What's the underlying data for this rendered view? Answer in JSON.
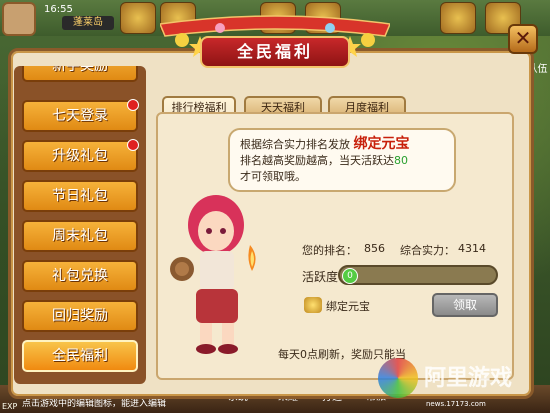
{
  "hud": {
    "time": "16:55",
    "server": "蓬莱岛"
  },
  "dialog": {
    "title": "全民福利",
    "close_label": "✕"
  },
  "menu": {
    "items": [
      {
        "label": "新手奖励",
        "badge": false
      },
      {
        "label": "七天登录",
        "badge": true
      },
      {
        "label": "升级礼包",
        "badge": true
      },
      {
        "label": "节日礼包",
        "badge": false
      },
      {
        "label": "周末礼包",
        "badge": false
      },
      {
        "label": "礼包兑换",
        "badge": false
      },
      {
        "label": "回归奖励",
        "badge": false
      },
      {
        "label": "全民福利",
        "badge": false,
        "active": true
      }
    ]
  },
  "tabs": [
    {
      "label": "排行榜福利"
    },
    {
      "label": "天天福利"
    },
    {
      "label": "月度福利"
    }
  ],
  "bubble": {
    "line1": "根据综合实力排名发放",
    "highlight": "绑定元宝",
    "line2a": "排名越高奖励越高，当天活跃达",
    "line2_num": "80",
    "line3": "才可领取哦。"
  },
  "stats": {
    "rank_label": "您的排名：",
    "rank_value": "856",
    "power_label": "综合实力：",
    "power_value": "4314",
    "activity_label": "活跃度",
    "activity_value": "0",
    "activity_fraction": 0
  },
  "reward": {
    "label": "绑定元宝",
    "claim_label": "领取"
  },
  "footer": {
    "note": "每天0点刷新，奖励只能当"
  },
  "bottom": {
    "tip": "点击游戏中的编辑图标，能进入编辑",
    "buttons": [
      "系统",
      "荣耀",
      "打造",
      "帮派"
    ],
    "xp": "EXP"
  },
  "side": {
    "label": "队伍"
  },
  "watermark": {
    "text": "阿里游戏",
    "url": "news.17173.com"
  }
}
